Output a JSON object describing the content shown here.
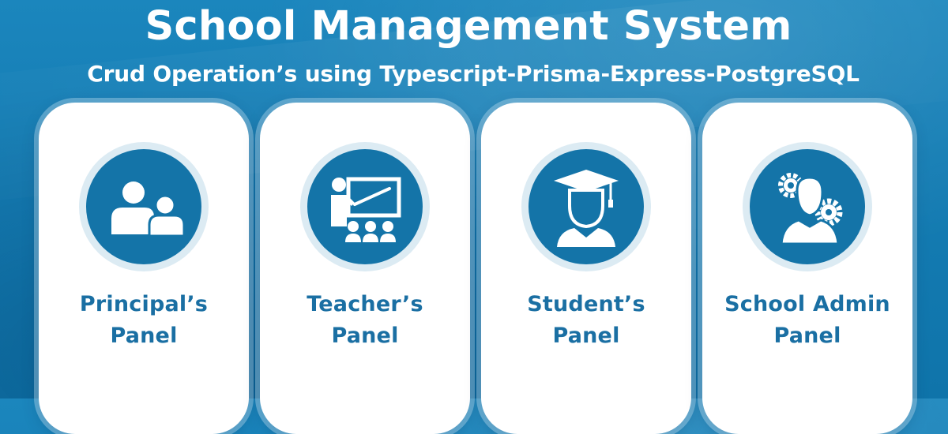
{
  "header": {
    "title": "School Management System",
    "subtitle": "Crud Operation’s using Typescript-Prisma-Express-PostgreSQL"
  },
  "panels": [
    {
      "line1": "Principal’s",
      "line2": "Panel",
      "icon": "principal-people-icon"
    },
    {
      "line1": "Teacher’s",
      "line2": "Panel",
      "icon": "teacher-board-icon"
    },
    {
      "line1": "Student’s",
      "line2": "Panel",
      "icon": "student-graduate-icon"
    },
    {
      "line1": "School Admin",
      "line2": "Panel",
      "icon": "admin-gears-icon"
    }
  ],
  "colors": {
    "background": "#1b86bd",
    "card": "#ffffff",
    "icon_circle": "#1474a8",
    "icon_ring": "#dcebf3",
    "label": "#1a6fa3"
  }
}
